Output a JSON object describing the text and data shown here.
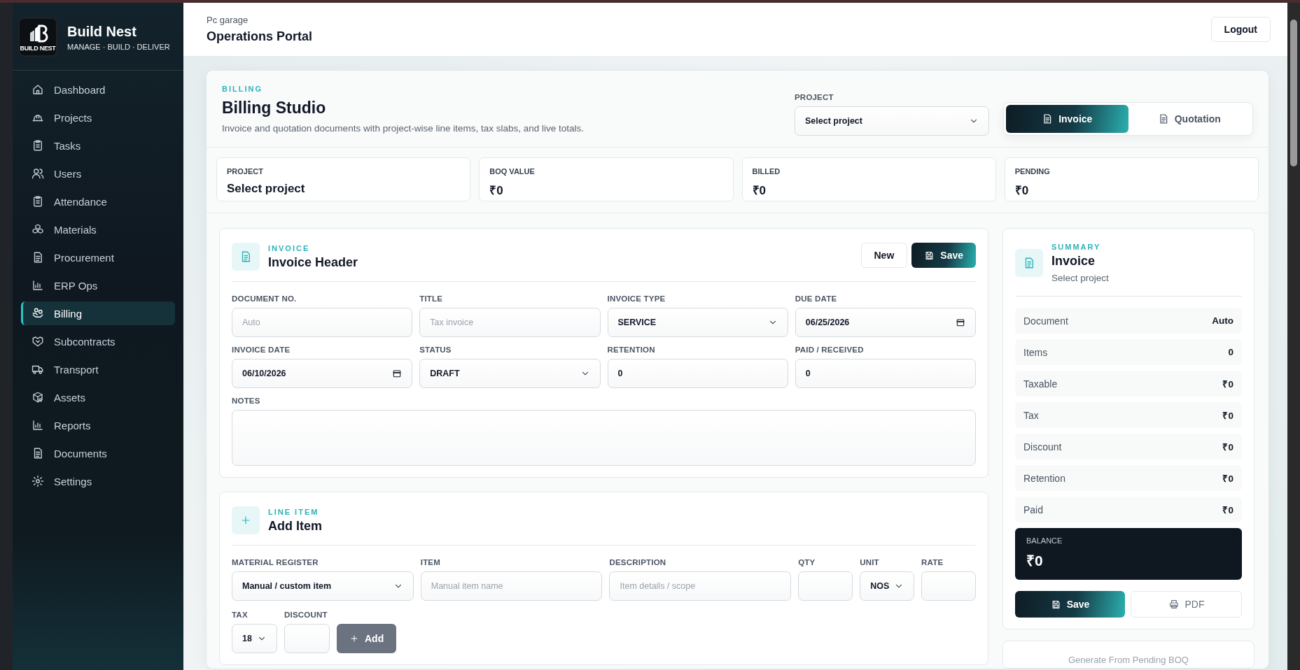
{
  "sidebar": {
    "brand": {
      "logo_text": "BUILD NEST",
      "name": "Build Nest",
      "tagline": "MANAGE · BUILD · DELIVER"
    },
    "items": [
      {
        "label": "Dashboard",
        "selected": false
      },
      {
        "label": "Projects",
        "selected": false
      },
      {
        "label": "Tasks",
        "selected": false
      },
      {
        "label": "Users",
        "selected": false
      },
      {
        "label": "Attendance",
        "selected": false
      },
      {
        "label": "Materials",
        "selected": false
      },
      {
        "label": "Procurement",
        "selected": false
      },
      {
        "label": "ERP Ops",
        "selected": false
      },
      {
        "label": "Billing",
        "selected": true
      },
      {
        "label": "Subcontracts",
        "selected": false
      },
      {
        "label": "Transport",
        "selected": false
      },
      {
        "label": "Assets",
        "selected": false
      },
      {
        "label": "Reports",
        "selected": false
      },
      {
        "label": "Documents",
        "selected": false
      },
      {
        "label": "Settings",
        "selected": false
      }
    ]
  },
  "header": {
    "org": "Pc garage",
    "title": "Operations Portal",
    "logout": "Logout"
  },
  "billing": {
    "eyebrow": "BILLING",
    "title": "Billing Studio",
    "subtitle": "Invoice and quotation documents with project-wise line items, tax slabs, and live totals.",
    "project_label": "PROJECT",
    "project_value": "Select project",
    "modes": [
      {
        "label": "Invoice",
        "selected": true
      },
      {
        "label": "Quotation",
        "selected": false
      }
    ]
  },
  "stats": [
    {
      "label": "PROJECT",
      "value": "Select project"
    },
    {
      "label": "BOQ VALUE",
      "value": "₹0"
    },
    {
      "label": "BILLED",
      "value": "₹0"
    },
    {
      "label": "PENDING",
      "value": "₹0"
    }
  ],
  "invoice_header": {
    "eyebrow": "INVOICE",
    "title": "Invoice Header",
    "new_button": "New",
    "save_button": "Save",
    "fields": [
      {
        "kind": "text",
        "label": "DOCUMENT NO.",
        "placeholder": "Auto"
      },
      {
        "kind": "text",
        "label": "TITLE",
        "placeholder": "Tax invoice"
      },
      {
        "kind": "select",
        "label": "INVOICE TYPE",
        "value": "SERVICE"
      },
      {
        "kind": "date",
        "label": "DUE DATE",
        "value": "06/25/2026"
      },
      {
        "kind": "date",
        "label": "INVOICE DATE",
        "value": "06/10/2026"
      },
      {
        "kind": "select",
        "label": "STATUS",
        "value": "DRAFT"
      },
      {
        "kind": "text",
        "label": "RETENTION",
        "value": "0"
      },
      {
        "kind": "text",
        "label": "PAID / RECEIVED",
        "value": "0"
      },
      {
        "kind": "textarea",
        "label": "NOTES"
      }
    ]
  },
  "line_item": {
    "eyebrow": "LINE ITEM",
    "title": "Add Item",
    "fields": [
      {
        "kind": "select",
        "label": "MATERIAL REGISTER",
        "value": "Manual / custom item"
      },
      {
        "kind": "text",
        "label": "ITEM",
        "placeholder": "Manual item name"
      },
      {
        "kind": "text",
        "label": "DESCRIPTION",
        "placeholder": "Item details / scope"
      },
      {
        "kind": "text",
        "label": "QTY"
      },
      {
        "kind": "select",
        "label": "UNIT",
        "value": "NOS"
      },
      {
        "kind": "text",
        "label": "RATE"
      }
    ],
    "extra_fields": [
      {
        "kind": "select",
        "label": "TAX",
        "value": "18"
      },
      {
        "kind": "text",
        "label": "DISCOUNT"
      }
    ],
    "add_button": "Add"
  },
  "summary": {
    "eyebrow": "SUMMARY",
    "title": "Invoice",
    "subtitle": "Select project",
    "rows": [
      {
        "label": "Document",
        "value": "Auto"
      },
      {
        "label": "Items",
        "value": "0"
      },
      {
        "label": "Taxable",
        "value": "₹0"
      },
      {
        "label": "Tax",
        "value": "₹0"
      },
      {
        "label": "Discount",
        "value": "₹0"
      },
      {
        "label": "Retention",
        "value": "₹0"
      },
      {
        "label": "Paid",
        "value": "₹0"
      }
    ],
    "balance": {
      "label": "BALANCE",
      "value": "₹0"
    },
    "save_button": "Save",
    "pdf_button": "PDF"
  },
  "boq_button": "Generate From Pending BOQ"
}
